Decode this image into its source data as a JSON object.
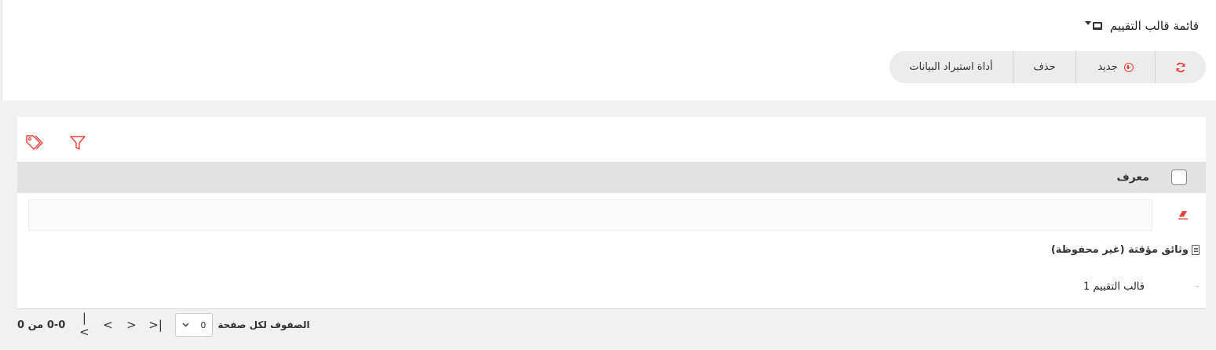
{
  "header": {
    "title": "قائمة قالب التقييم",
    "title_icon": "screen-dropdown-icon"
  },
  "toolbar": {
    "refresh_icon": "refresh-icon",
    "new_label": "جديد",
    "delete_label": "حذف",
    "import_label": "أداة استيراد البيانات"
  },
  "table": {
    "tools": [
      "tags-icon",
      "filter-icon"
    ],
    "column_header": "معرف",
    "group_title": "وثائق مؤقتة (غير محفوظة)",
    "rows": [
      {
        "dash": "-",
        "label": "قالب التقييم 1"
      }
    ]
  },
  "pagination": {
    "info": "0-0 من 0",
    "rows_per_page_label": "الصفوف لكل صفحة",
    "rows_per_page_value": "0"
  },
  "colors": {
    "accent": "#e8403b",
    "header_bg": "#e2e2e2",
    "toolbar_bg": "#ececec"
  }
}
